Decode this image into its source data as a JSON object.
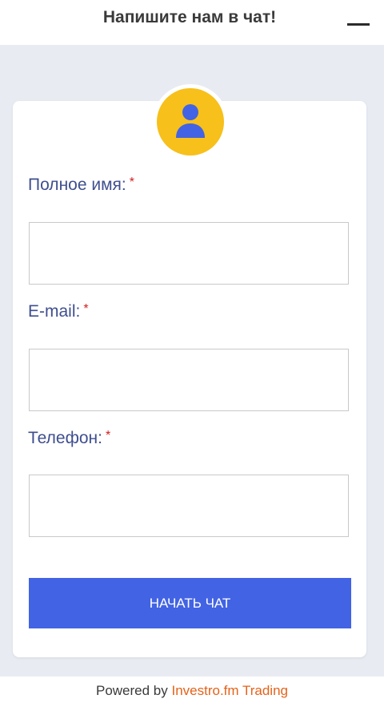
{
  "header": {
    "title": "Напишите нам в чат!",
    "minimize_icon": "minimize-icon"
  },
  "avatar": {
    "icon": "user-icon",
    "bg_color": "#f7c01a",
    "icon_color": "#4263e3"
  },
  "form": {
    "fields": [
      {
        "label": "Полное имя:",
        "required_mark": "*",
        "value": ""
      },
      {
        "label": "E-mail:",
        "required_mark": "*",
        "value": ""
      },
      {
        "label": "Телефон:",
        "required_mark": "*",
        "value": ""
      }
    ],
    "submit_label": "НАЧАТЬ ЧАТ",
    "accent_color": "#4263e3"
  },
  "footer": {
    "prefix": "Powered by ",
    "brand": "Investro.fm Trading",
    "brand_color": "#e5621a"
  }
}
